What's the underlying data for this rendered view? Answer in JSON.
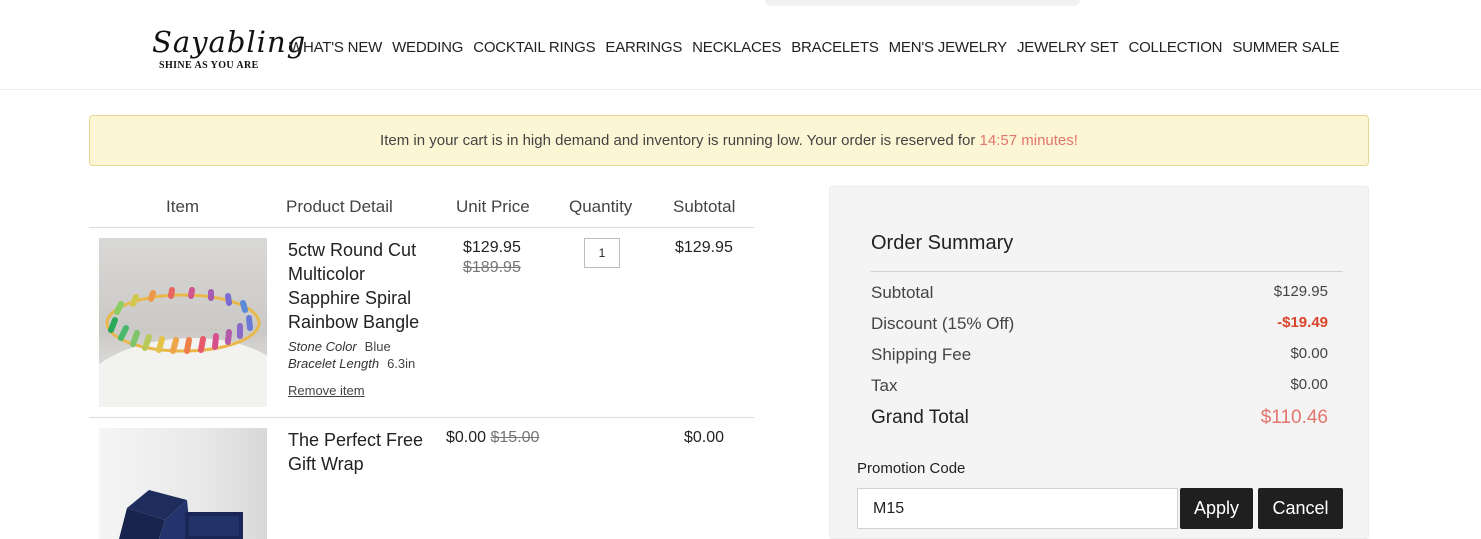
{
  "header": {
    "logo_main": "Sayabling",
    "logo_tagline": "SHINE AS YOU ARE",
    "nav": [
      "WHAT'S NEW",
      "WEDDING",
      "COCKTAIL RINGS",
      "EARRINGS",
      "NECKLACES",
      "BRACELETS",
      "MEN'S JEWELRY",
      "JEWELRY SET",
      "COLLECTION",
      "SUMMER SALE"
    ]
  },
  "alert": {
    "message": "Item in your cart is in high demand and inventory is running low. Your order is reserved for ",
    "timer": "14:57 minutes!"
  },
  "cart": {
    "columns": [
      "Item",
      "Product Detail",
      "Unit Price",
      "Quantity",
      "Subtotal"
    ],
    "items": [
      {
        "name": "5ctw Round Cut Multicolor Sapphire Spiral Rainbow Bangle",
        "attr1_label": "Stone Color",
        "attr1_value": "Blue",
        "attr2_label": "Bracelet Length",
        "attr2_value": "6.3in",
        "remove": "Remove item",
        "price": "$129.95",
        "original_price": "$189.95",
        "quantity": "1",
        "subtotal": "$129.95"
      },
      {
        "name": "The Perfect Free Gift Wrap",
        "price": "$0.00",
        "original_price": "$15.00",
        "subtotal": "$0.00"
      }
    ]
  },
  "summary": {
    "title": "Order Summary",
    "rows": [
      {
        "label": "Subtotal",
        "value": "$129.95"
      },
      {
        "label": "Discount (15% Off)",
        "value": "-$19.49"
      },
      {
        "label": "Shipping Fee",
        "value": "$0.00"
      },
      {
        "label": "Tax",
        "value": "$0.00"
      }
    ],
    "grand_label": "Grand Total",
    "grand_value": "$110.46",
    "promo_label": "Promotion Code",
    "promo_value": "M15",
    "apply": "Apply",
    "cancel": "Cancel"
  },
  "colors": {
    "timer": "#e2766f",
    "discount": "#d9452b",
    "grand_total": "#e2766f",
    "button": "#1f1f1f",
    "alert_bg": "#fcf6d4"
  }
}
